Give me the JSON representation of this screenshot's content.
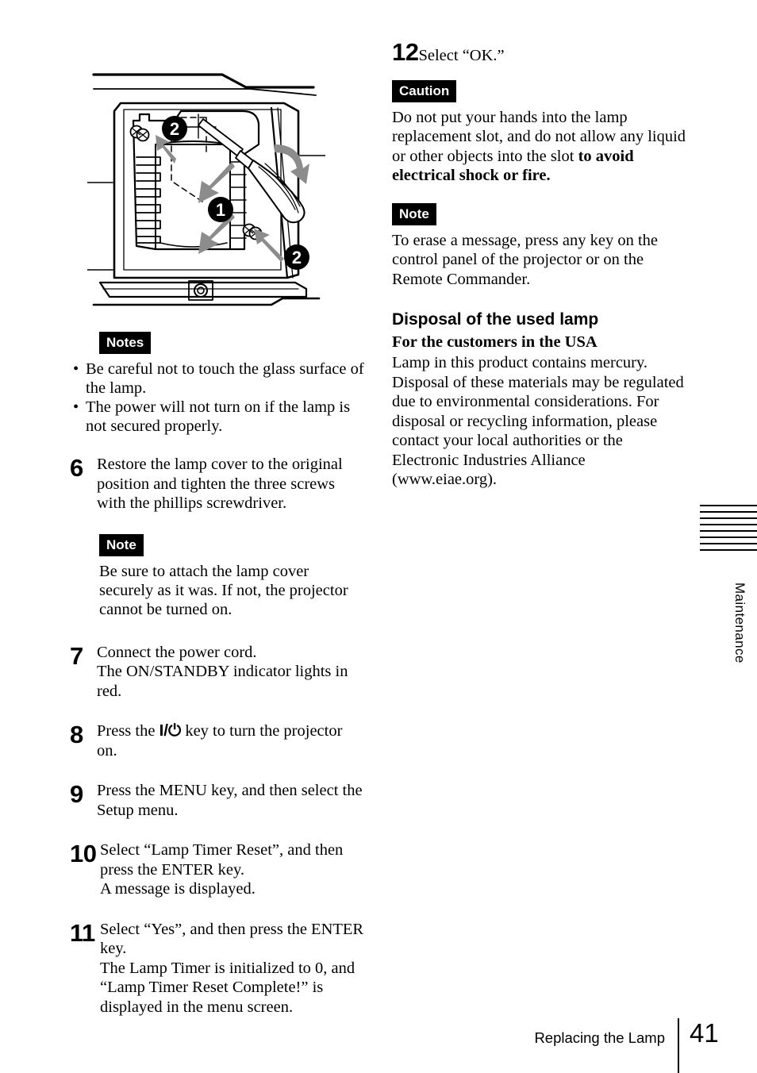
{
  "page": {
    "number": "41",
    "footer_title": "Replacing the Lamp",
    "side_tab_label": "Maintenance"
  },
  "illustration": {
    "caption": "Lamp replacement slot with lamp unit, screws and phillips screwdriver",
    "callouts": [
      "1",
      "2",
      "2"
    ]
  },
  "left_column": {
    "notes_badge": "Notes",
    "notes_items": [
      "Be careful not to touch the glass surface of the lamp.",
      "The power will not turn on if the lamp is not secured properly."
    ],
    "step6": {
      "number": "6",
      "text": "Restore the lamp cover to the original position and tighten the three screws with the phillips screwdriver.",
      "note_badge": "Note",
      "note_text": "Be sure to attach the lamp cover securely as it was. If not, the projector cannot be turned on."
    },
    "step7": {
      "number": "7",
      "text": "Connect the power cord.",
      "detail": "The ON/STANDBY indicator lights in red."
    },
    "step8": {
      "number": "8",
      "text_before": "Press the ",
      "power_symbol": "I/⏻",
      "text_after": " key to turn the projector on."
    },
    "step9": {
      "number": "9",
      "text": "Press the MENU key, and then select the Setup menu."
    },
    "step10": {
      "number": "10",
      "text": "Select “Lamp Timer Reset”, and then press the ENTER key.",
      "detail": "A message is displayed."
    },
    "step11": {
      "number": "11",
      "text": "Select “Yes”, and then press the ENTER key.",
      "detail": "The Lamp Timer is initialized to 0, and “Lamp Timer Reset Complete!” is displayed in the menu screen."
    }
  },
  "right_column": {
    "step12": {
      "number": "12",
      "text": "Select “OK.”"
    },
    "caution_badge": "Caution",
    "caution_text_normal": "Do not put your hands into the lamp replacement slot, and do not allow any liquid or other objects into the slot ",
    "caution_text_bold": "to avoid electrical shock or fire.",
    "note_badge": "Note",
    "note_text": "To erase a message, press any key on the control panel of the projector or on the Remote Commander.",
    "disposal_heading": "Disposal of the used lamp",
    "disposal_subheading": "For the customers in the USA",
    "disposal_text": "Lamp in this product contains mercury. Disposal of these materials may be regulated due to environmental considerations. For disposal or recycling information, please contact your local authorities or the Electronic Industries Alliance (www.eiae.org)."
  }
}
